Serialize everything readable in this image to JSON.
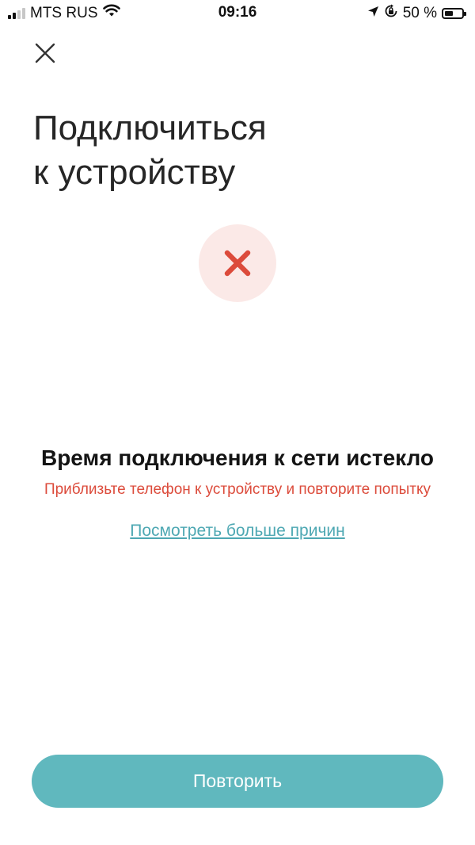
{
  "status_bar": {
    "carrier": "MTS RUS",
    "time": "09:16",
    "battery_percent": "50 %",
    "battery_level": 0.5,
    "signal_bars_active": 2,
    "signal_bars_total": 4,
    "icons": [
      "signal-icon",
      "wifi-icon",
      "location-arrow-icon",
      "orientation-lock-icon",
      "battery-icon"
    ]
  },
  "header": {
    "close_icon": "close-icon"
  },
  "page": {
    "title_line1": "Подключиться",
    "title_line2": "к устройству"
  },
  "status": {
    "icon": "error-x-icon",
    "icon_color": "#dc4b3b",
    "icon_bg": "#fbe9e7",
    "title": "Время подключения к сети истекло",
    "hint": "Приблизьте телефон к устройству и повторите попытку",
    "hint_color": "#dc4b3b",
    "more_link": "Посмотреть больше причин"
  },
  "actions": {
    "retry_label": "Повторить",
    "accent_color": "#60b8be"
  }
}
